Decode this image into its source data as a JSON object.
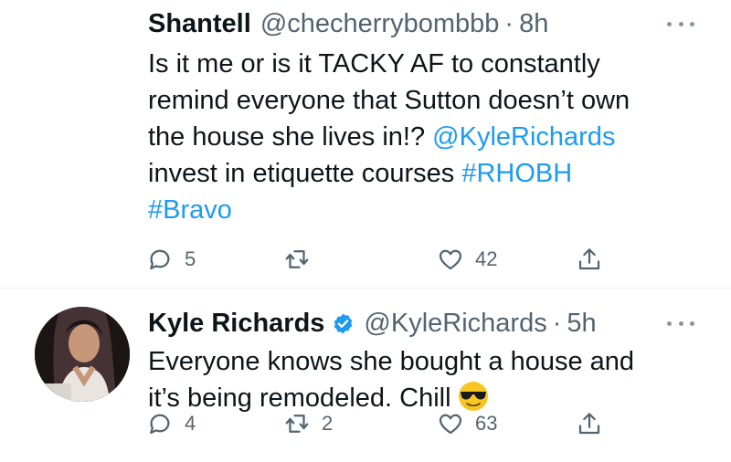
{
  "tweets": [
    {
      "display_name": "Shantell",
      "handle": "@checherrybombbb",
      "separator": "·",
      "time": "8h",
      "body": {
        "line1": "Is it me or is it TACKY AF to constantly",
        "line2": "remind everyone that Sutton doesn’t own",
        "line3_text": "the house she lives in!? ",
        "line3_mention": "@KyleRichards",
        "line4_text": "invest in etiquette courses ",
        "line4_hashtag": "#RHOBH",
        "line5_hashtag": "#Bravo"
      },
      "actions": {
        "replies": "5",
        "retweets": "",
        "likes": "42"
      },
      "icons": [
        "reply-icon",
        "retweet-icon",
        "like-icon",
        "share-icon",
        "more-icon"
      ]
    },
    {
      "display_name": "Kyle Richards",
      "verified": true,
      "handle": "@KyleRichards",
      "separator": "·",
      "time": "5h",
      "body": {
        "line1": "Everyone knows she bought a house and",
        "line2": "it’s being remodeled. Chill"
      },
      "emoji": "sunglasses-emoji",
      "actions": {
        "replies": "4",
        "retweets": "2",
        "likes": "63"
      },
      "icons": [
        "reply-icon",
        "retweet-icon",
        "like-icon",
        "share-icon",
        "more-icon",
        "verified-badge-icon"
      ]
    }
  ],
  "colors": {
    "link": "#1d9bf0",
    "secondary_text": "#536471",
    "primary_text": "#0f1419",
    "verified_badge": "#1d9bf0",
    "emoji_face": "#f7c623"
  }
}
